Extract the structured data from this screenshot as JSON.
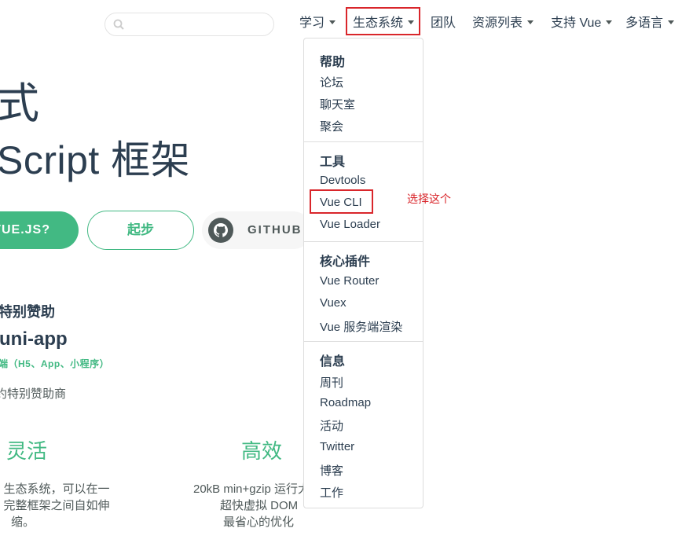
{
  "search": {
    "value": "",
    "placeholder": ""
  },
  "nav": [
    {
      "label": "学习",
      "dropdown": true
    },
    {
      "label": "生态系统",
      "dropdown": true,
      "active": true
    },
    {
      "label": "团队",
      "dropdown": false
    },
    {
      "label": "资源列表",
      "dropdown": true
    },
    {
      "label": "支持 Vue",
      "dropdown": true
    },
    {
      "label": "多语言",
      "dropdown": true
    }
  ],
  "hero": {
    "line1": "式",
    "line2": "Script 框架",
    "btn_why": "VUE.JS?",
    "btn_start": "起步",
    "btn_github": "GITHUB"
  },
  "sponsor": {
    "title": "特别赞助",
    "name": "uni-app",
    "sub": "端（H5、App、小程序）",
    "note": "约特别赞助商"
  },
  "features": [
    {
      "title": "灵活",
      "lines": [
        "生态系统，可以在一",
        "完整框架之间自如伸",
        "缩。"
      ]
    },
    {
      "title": "高效",
      "lines": [
        "20kB min+gzip 运行大",
        "超快虚拟 DOM",
        "最省心的优化"
      ]
    }
  ],
  "dropdown": {
    "groups": [
      {
        "heading": "帮助",
        "items": [
          "论坛",
          "聊天室",
          "聚会"
        ]
      },
      {
        "heading": "工具",
        "items": [
          "Devtools",
          "Vue CLI",
          "Vue Loader"
        ]
      },
      {
        "heading": "核心插件",
        "items": [
          "Vue Router",
          "Vuex",
          "Vue 服务端渲染"
        ]
      },
      {
        "heading": "信息",
        "items": [
          "周刊",
          "Roadmap",
          "活动",
          "Twitter",
          "博客",
          "工作"
        ]
      }
    ]
  },
  "annotation": "选择这个",
  "colors": {
    "brand": "#42b983",
    "text": "#2c3e50",
    "annotation": "#d9262b"
  }
}
